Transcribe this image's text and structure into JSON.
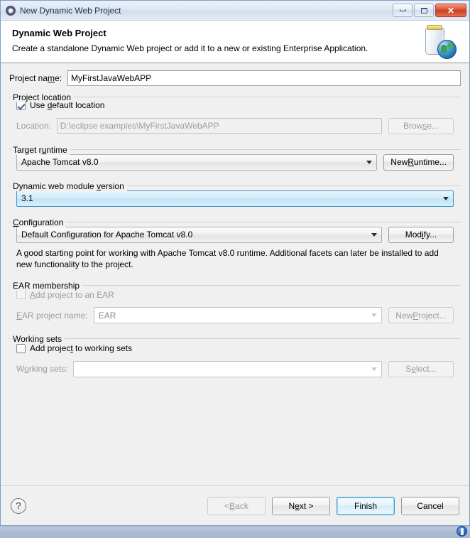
{
  "window": {
    "title": "New Dynamic Web Project",
    "icon": "eclipse-wizard-icon",
    "minimize_label": "Minimize",
    "maximize_label": "Maximize",
    "close_label": "Close"
  },
  "header": {
    "title": "Dynamic Web Project",
    "description": "Create a standalone Dynamic Web project or add it to a new or existing Enterprise Application.",
    "icon": "jar-globe-icon"
  },
  "project_name": {
    "label": "Project na",
    "label_mnemonic": "m",
    "label_tail": "e:",
    "value": "MyFirstJavaWebAPP",
    "placeholder": ""
  },
  "project_location": {
    "group_title": "Project location",
    "use_default": {
      "label_pre": "Use ",
      "label_mnemonic": "d",
      "label_post": "efault location",
      "checked": true
    },
    "location": {
      "label": "Location:",
      "value": "D:\\eclipse examples\\MyFirstJavaWebAPP",
      "disabled": true
    },
    "browse_button": {
      "label_pre": "Brow",
      "label_mnemonic": "s",
      "label_post": "e...",
      "disabled": true
    }
  },
  "target_runtime": {
    "group_title_pre": "Target r",
    "group_title_mnemonic": "u",
    "group_title_post": "ntime",
    "selected": "Apache Tomcat v8.0",
    "new_runtime_button": {
      "label_pre": "New ",
      "label_mnemonic": "R",
      "label_post": "untime..."
    }
  },
  "module_version": {
    "group_title_pre": "Dynamic web module ",
    "group_title_mnemonic": "v",
    "group_title_post": "ersion",
    "selected": "3.1",
    "focused": true
  },
  "configuration": {
    "group_title_mnemonic": "C",
    "group_title_post": "onfiguration",
    "selected": "Default Configuration for Apache Tomcat v8.0",
    "modify_button": {
      "label_pre": "Mod",
      "label_mnemonic": "i",
      "label_post": "fy..."
    },
    "description": "A good starting point for working with Apache Tomcat v8.0 runtime. Additional facets can later be installed to add new functionality to the project."
  },
  "ear_membership": {
    "group_title": "EAR membership",
    "add_to_ear": {
      "label_mnemonic": "A",
      "label_post": "dd project to an EAR",
      "checked": false,
      "disabled": true
    },
    "ear_project_name": {
      "label_mnemonic": "E",
      "label_post": "AR project name:",
      "value": "EAR",
      "disabled": true
    },
    "new_project_button": {
      "label_pre": "New ",
      "label_mnemonic": "P",
      "label_post": "roject...",
      "disabled": true
    }
  },
  "working_sets": {
    "group_title": "Working sets",
    "add_to_working_sets": {
      "label_pre": "Add projec",
      "label_mnemonic": "t",
      "label_post": " to working sets",
      "checked": false
    },
    "working_sets_field": {
      "label_pre": "W",
      "label_mnemonic": "o",
      "label_post": "rking sets:",
      "value": "",
      "disabled": true
    },
    "select_button": {
      "label_pre": "S",
      "label_mnemonic": "e",
      "label_post": "lect...",
      "disabled": true
    }
  },
  "footer": {
    "help_label": "?",
    "back_button": {
      "label_pre": "< ",
      "label_mnemonic": "B",
      "label_post": "ack",
      "disabled": true
    },
    "next_button": {
      "label_pre": "N",
      "label_mnemonic": "e",
      "label_post": "xt >",
      "disabled": false
    },
    "finish_button": {
      "label": "Finish",
      "is_default": true
    },
    "cancel_button": {
      "label": "Cancel"
    }
  },
  "colors": {
    "window_border": "#7ca0c7",
    "body_bg": "#f0f0f0",
    "header_bg": "#ffffff",
    "focus_blue": "#3c93c8",
    "default_button_border": "#3c9bd4",
    "close_red": "#c93f24",
    "taskbar": "#aebdd4"
  }
}
